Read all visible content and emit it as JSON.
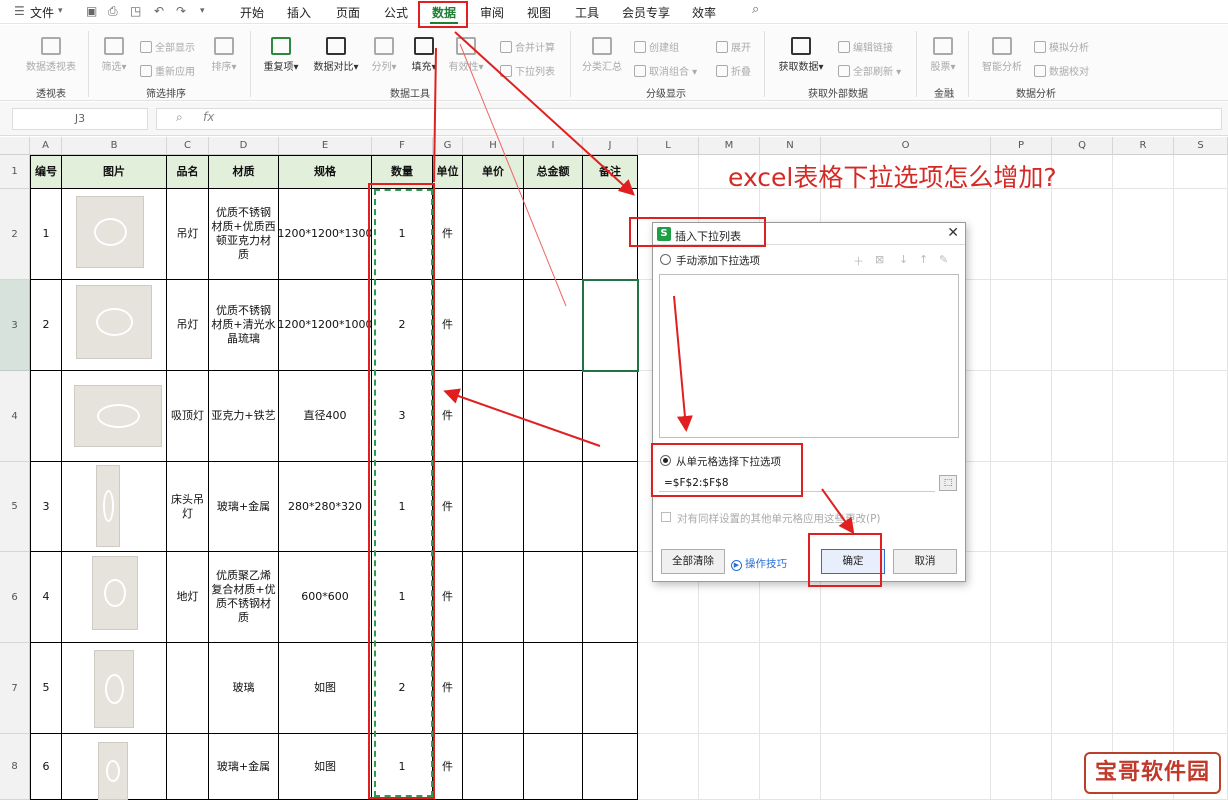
{
  "menubar": {
    "file": "文件",
    "tabs": [
      "开始",
      "插入",
      "页面",
      "公式",
      "数据",
      "审阅",
      "视图",
      "工具",
      "会员专享",
      "效率"
    ],
    "active_tab_index": 4
  },
  "ribbon": {
    "buttons": {
      "pivot": "数据透视表",
      "filter": "筛选",
      "show_all": "全部显示",
      "reapply": "重新应用",
      "sort": "排序",
      "duplicates": "重复项",
      "compare": "数据对比",
      "split": "分列",
      "fill": "填充",
      "validity": "有效性",
      "merge_calc": "合并计算",
      "dropdown_list": "下拉列表",
      "subtotal": "分类汇总",
      "group": "创建组",
      "ungroup": "取消组合",
      "expand": "展开",
      "collapse": "折叠",
      "get_data": "获取数据",
      "edit_links": "编辑链接",
      "refresh_all": "全部刷新",
      "stocks": "股票",
      "smart_analysis": "智能分析",
      "simulation": "模拟分析",
      "verify": "数据校对"
    },
    "groups": {
      "pivot": "透视表",
      "filter_sort": "筛选排序",
      "data_tools": "数据工具",
      "outline": "分级显示",
      "external": "获取外部数据",
      "finance": "金融",
      "analysis": "数据分析"
    }
  },
  "formula_bar": {
    "name_box": "J3",
    "fx": "fx",
    "value": ""
  },
  "columns": [
    "A",
    "B",
    "C",
    "D",
    "E",
    "F",
    "G",
    "H",
    "I",
    "J",
    "L",
    "M",
    "N",
    "O",
    "P",
    "Q",
    "R",
    "S"
  ],
  "rows": [
    "1",
    "2",
    "3",
    "4",
    "5",
    "6",
    "7",
    "8"
  ],
  "table": {
    "headers": [
      "编号",
      "图片",
      "品名",
      "材质",
      "规格",
      "数量",
      "单位",
      "单价",
      "总金额",
      "备注"
    ],
    "data": [
      [
        "1",
        "",
        "吊灯",
        "优质不锈钢材质+优质西顿亚克力材质",
        "1200*1200*1300",
        "1",
        "件",
        "",
        "",
        ""
      ],
      [
        "2",
        "",
        "吊灯",
        "优质不锈钢材质+清光水晶琉璃",
        "1200*1200*1000",
        "2",
        "件",
        "",
        "",
        ""
      ],
      [
        "",
        "",
        "吸顶灯",
        "亚克力+铁艺",
        "直径400",
        "3",
        "件",
        "",
        "",
        ""
      ],
      [
        "3",
        "",
        "床头吊灯",
        "玻璃+金属",
        "280*280*320",
        "1",
        "件",
        "",
        "",
        ""
      ],
      [
        "4",
        "",
        "地灯",
        "优质聚乙烯复合材质+优质不锈钢材质",
        "600*600",
        "1",
        "件",
        "",
        "",
        ""
      ],
      [
        "5",
        "",
        "",
        "玻璃",
        "如图",
        "2",
        "件",
        "",
        "",
        ""
      ],
      [
        "6",
        "",
        "",
        "玻璃+金属",
        "如图",
        "1",
        "件",
        "",
        "",
        ""
      ]
    ]
  },
  "annotation_title": "excel表格下拉选项怎么增加?",
  "dialog": {
    "title": "插入下拉列表",
    "option_manual": "手动添加下拉选项",
    "option_cells": "从单元格选择下拉选项",
    "range": "=$F$2:$F$8",
    "apply_checkbox": "对有同样设置的其他单元格应用这些更改(P)",
    "clear_all": "全部清除",
    "help": "操作技巧",
    "ok": "确定",
    "cancel": "取消"
  },
  "watermark": "宝哥软件园",
  "colors": {
    "header_fill": "#e2efda",
    "annotation_red": "#e02020",
    "selection_green": "#217346"
  }
}
